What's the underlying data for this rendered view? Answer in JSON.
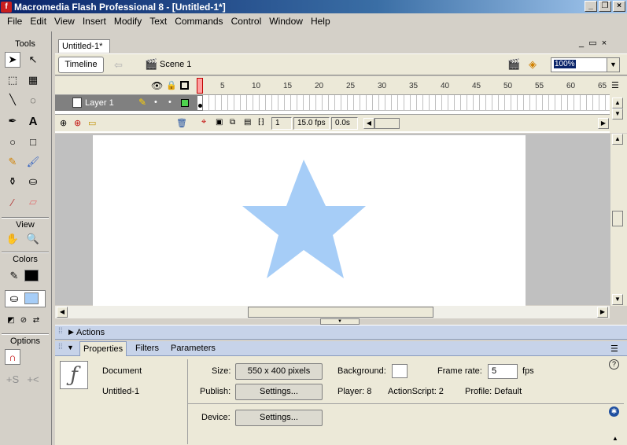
{
  "window": {
    "title": "Macromedia Flash Professional 8 - [Untitled-1*]"
  },
  "menu": [
    "File",
    "Edit",
    "View",
    "Insert",
    "Modify",
    "Text",
    "Commands",
    "Control",
    "Window",
    "Help"
  ],
  "tools": {
    "header": "Tools",
    "view_header": "View",
    "colors_header": "Colors",
    "options_header": "Options"
  },
  "document": {
    "tab": "Untitled-1*",
    "timeline_label": "Timeline",
    "scene_label": "Scene 1",
    "zoom": "100%"
  },
  "timeline": {
    "layer_name": "Layer 1",
    "frame_numbers": [
      "1",
      "5",
      "10",
      "15",
      "20",
      "25",
      "30",
      "35",
      "40",
      "45",
      "50",
      "55",
      "60",
      "65"
    ],
    "current_frame": "1",
    "fps": "15.0 fps",
    "time": "0.0s"
  },
  "stage": {
    "shape_color": "#a6cdf7",
    "background": "#ffffff"
  },
  "panels": {
    "actions_label": "Actions",
    "tabs": [
      "Properties",
      "Filters",
      "Parameters"
    ]
  },
  "properties": {
    "type": "Document",
    "name": "Untitled-1",
    "size_label": "Size:",
    "size_value": "550 x 400 pixels",
    "background_label": "Background:",
    "frame_rate_label": "Frame rate:",
    "frame_rate_value": "5",
    "fps_unit": "fps",
    "publish_label": "Publish:",
    "settings_label": "Settings...",
    "player_text": "Player: 8",
    "actionscript_text": "ActionScript: 2",
    "profile_text": "Profile: Default",
    "device_label": "Device:",
    "device_settings_label": "Settings..."
  }
}
